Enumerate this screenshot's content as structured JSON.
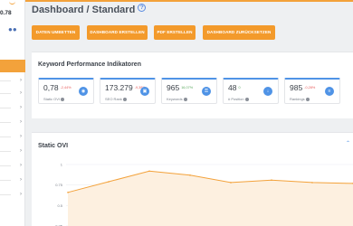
{
  "sidebar": {
    "value": "0.78",
    "users_icon": "users-icon",
    "items": [
      {
        "icon": "chevron-right-icon",
        "glyph": "›"
      },
      {
        "icon": "chevron-right-icon",
        "glyph": "›"
      },
      {
        "icon": "chevron-right-icon",
        "glyph": "›"
      },
      {
        "icon": "chevron-right-icon",
        "glyph": "›"
      },
      {
        "icon": "chevron-right-icon",
        "glyph": "›"
      },
      {
        "icon": "chevron-right-icon",
        "glyph": "›"
      },
      {
        "icon": "chevron-right-icon",
        "glyph": "›"
      },
      {
        "icon": "chevron-right-icon",
        "glyph": "›"
      },
      {
        "icon": "chevron-right-icon",
        "glyph": "›"
      }
    ]
  },
  "header": {
    "title": "Dashboard / Standard",
    "help_icon": "?"
  },
  "toolbar": {
    "buttons": [
      {
        "label": "DATEN UMBETTEN"
      },
      {
        "label": "DASHBOARD ERSTELLEN"
      },
      {
        "label": "PDF ERSTELLEN"
      },
      {
        "label": "DASHBOARD ZURÜCKSETZEN"
      }
    ]
  },
  "kpi_panel": {
    "title": "Keyword Performance Indikatoren",
    "cards": [
      {
        "value": "0,78",
        "change": "-2,44%",
        "label": "Static OVI",
        "icon": "gauge-icon",
        "glyph": "◉"
      },
      {
        "value": "173.279",
        "change": "-9,38%",
        "label": "SEO Rank",
        "icon": "trophy-icon",
        "glyph": "▣"
      },
      {
        "value": "965",
        "change": "16,07%",
        "change_up": true,
        "label": "Keywords",
        "icon": "key-icon",
        "glyph": "⚿"
      },
      {
        "value": "48",
        "change": "0",
        "change_up": true,
        "label": "# Position",
        "icon": "download-icon",
        "glyph": "↓"
      },
      {
        "value": "985",
        "change": "-0,28%",
        "label": "Rankings",
        "icon": "list-icon",
        "glyph": "≡"
      }
    ]
  },
  "chart_panel": {
    "title": "Static OVI",
    "collapse_icon": "chevron-up-icon",
    "collapse_glyph": "⌃",
    "fill_color": "#fdf0e0",
    "line_color": "#f3a23b"
  },
  "chart_data": {
    "type": "area",
    "title": "Static OVI",
    "y_ticks": [
      "1",
      "0.75",
      "0.5",
      "0.25"
    ],
    "ylim": [
      0.25,
      1
    ],
    "values": [
      0.66,
      0.79,
      0.92,
      0.87,
      0.78,
      0.81,
      0.78,
      0.77
    ],
    "grid": true
  }
}
